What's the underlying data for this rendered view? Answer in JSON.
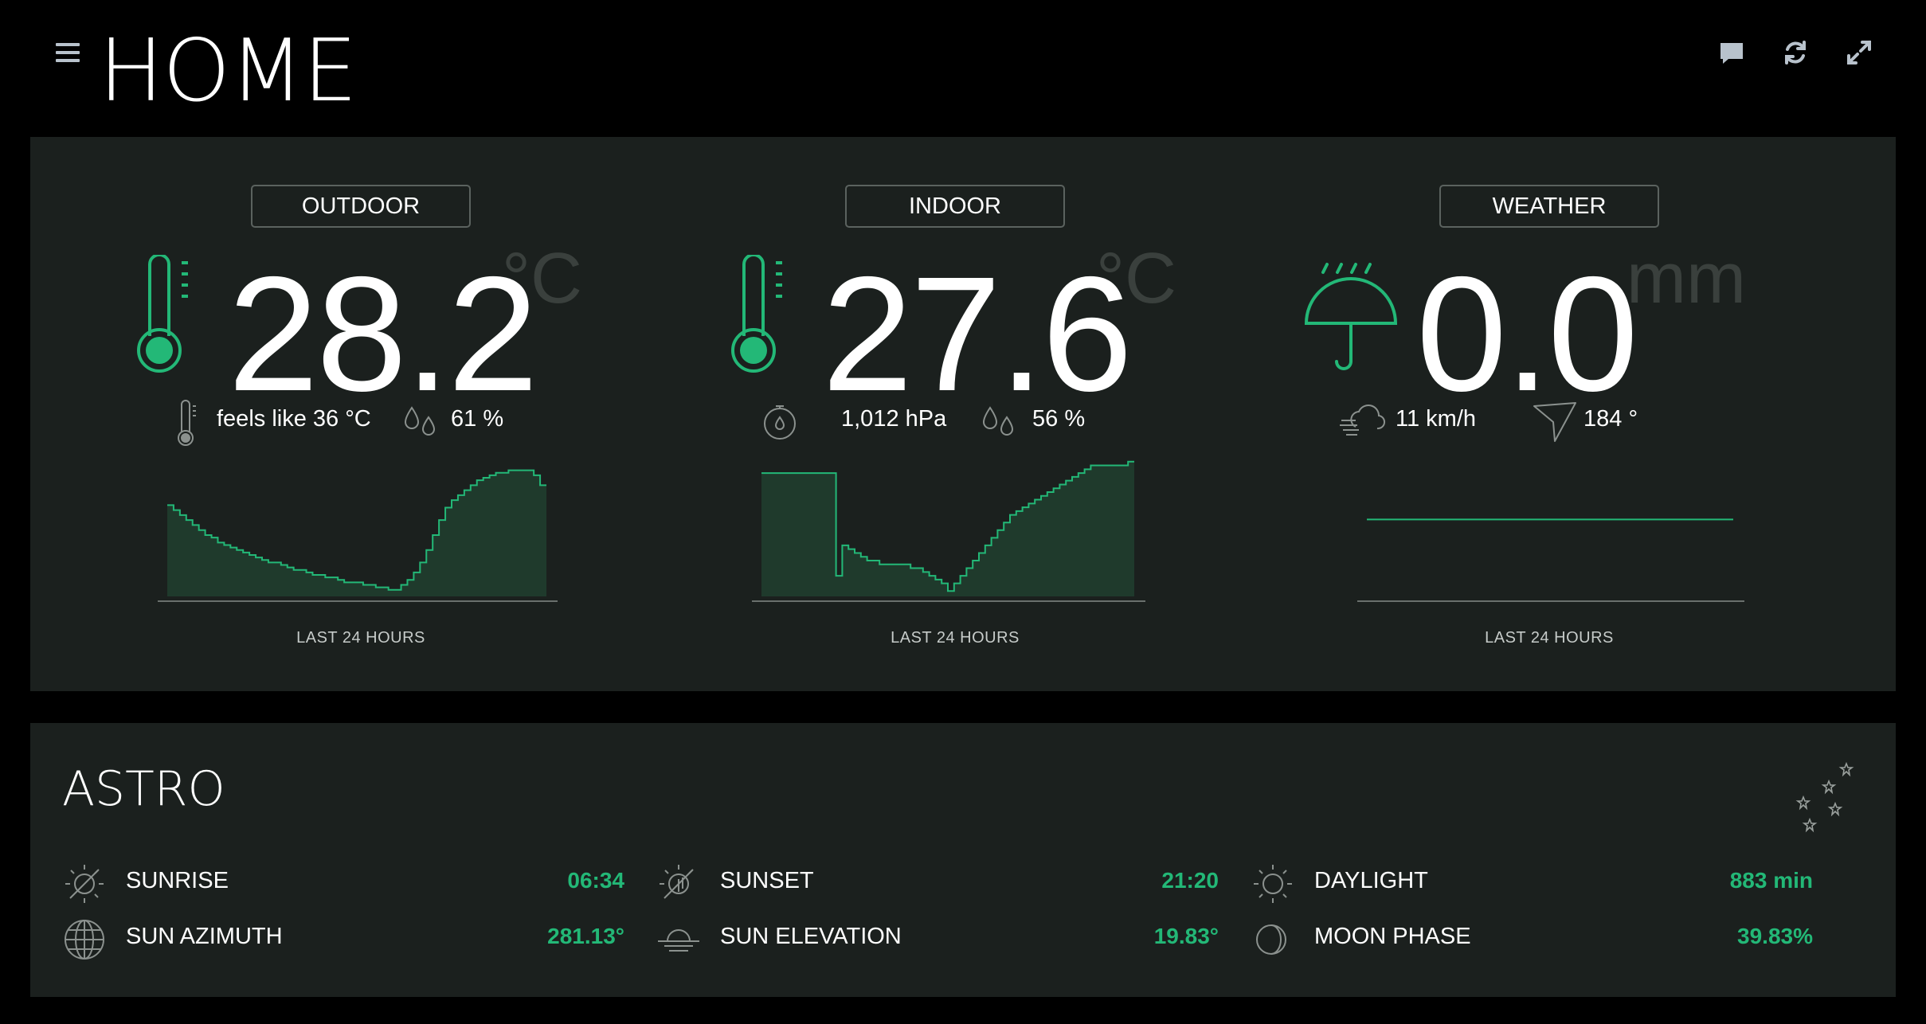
{
  "header": {
    "title": "HOME",
    "icons": [
      "menu-icon",
      "chat-icon",
      "refresh-icon",
      "fullscreen-icon"
    ]
  },
  "colors": {
    "accent": "#23b877",
    "panel": "#1b201e",
    "background": "#000000",
    "muted_unit": "#3a403d"
  },
  "outdoor": {
    "label": "OUTDOOR",
    "value": "28.2",
    "unit": "°C",
    "feels_like": "feels like 36 °C",
    "humidity": "61 %",
    "caption": "LAST 24 HOURS"
  },
  "indoor": {
    "label": "INDOOR",
    "value": "27.6",
    "unit": "°C",
    "pressure": "1,012 hPa",
    "humidity": "56 %",
    "caption": "LAST 24 HOURS"
  },
  "weather": {
    "label": "WEATHER",
    "value": "0.0",
    "unit": "mm",
    "wind_speed": "11 km/h",
    "wind_direction": "184 °",
    "caption": "LAST 24 HOURS"
  },
  "chart_data": [
    {
      "type": "area",
      "name": "outdoor",
      "values": [
        27.6,
        27.4,
        27.2,
        27.0,
        26.8,
        26.6,
        26.4,
        26.3,
        26.1,
        26.0,
        25.9,
        25.8,
        25.7,
        25.6,
        25.5,
        25.4,
        25.3,
        25.3,
        25.2,
        25.1,
        25.0,
        25.0,
        24.9,
        24.8,
        24.8,
        24.7,
        24.7,
        24.6,
        24.5,
        24.5,
        24.5,
        24.4,
        24.4,
        24.3,
        24.3,
        24.2,
        24.2,
        24.4,
        24.6,
        24.9,
        25.3,
        25.8,
        26.4,
        27.0,
        27.5,
        27.8,
        28.0,
        28.2,
        28.4,
        28.6,
        28.7,
        28.8,
        28.9,
        28.9,
        29.0,
        29.0,
        29.0,
        29.0,
        28.8,
        28.4
      ],
      "ylim": [
        24.0,
        29.5
      ]
    },
    {
      "type": "area",
      "name": "indoor",
      "values": [
        28.0,
        28.0,
        28.0,
        28.0,
        28.0,
        28.0,
        28.0,
        28.0,
        28.0,
        28.0,
        28.0,
        28.0,
        25.3,
        26.1,
        26.0,
        25.9,
        25.8,
        25.7,
        25.7,
        25.6,
        25.6,
        25.6,
        25.6,
        25.6,
        25.5,
        25.5,
        25.4,
        25.3,
        25.2,
        25.1,
        24.9,
        25.1,
        25.3,
        25.5,
        25.7,
        25.9,
        26.1,
        26.3,
        26.5,
        26.7,
        26.9,
        27.0,
        27.1,
        27.2,
        27.3,
        27.4,
        27.5,
        27.6,
        27.7,
        27.8,
        27.9,
        28.0,
        28.1,
        28.2,
        28.2,
        28.2,
        28.2,
        28.2,
        28.2,
        28.3
      ],
      "ylim": [
        24.8,
        28.4
      ]
    },
    {
      "type": "line",
      "name": "weather",
      "values": [
        0.0,
        0.0
      ],
      "ylim": [
        0,
        1
      ]
    }
  ],
  "astro": {
    "title": "ASTRO",
    "items": [
      {
        "label": "SUNRISE",
        "value": "06:34",
        "icon": "sunrise-icon"
      },
      {
        "label": "SUNSET",
        "value": "21:20",
        "icon": "sunset-icon"
      },
      {
        "label": "DAYLIGHT",
        "value": "883 min",
        "icon": "sun-icon"
      },
      {
        "label": "SUN AZIMUTH",
        "value": "281.13°",
        "icon": "globe-icon"
      },
      {
        "label": "SUN ELEVATION",
        "value": "19.83°",
        "icon": "horizon-icon"
      },
      {
        "label": "MOON PHASE",
        "value": "39.83%",
        "icon": "moon-icon"
      }
    ]
  }
}
